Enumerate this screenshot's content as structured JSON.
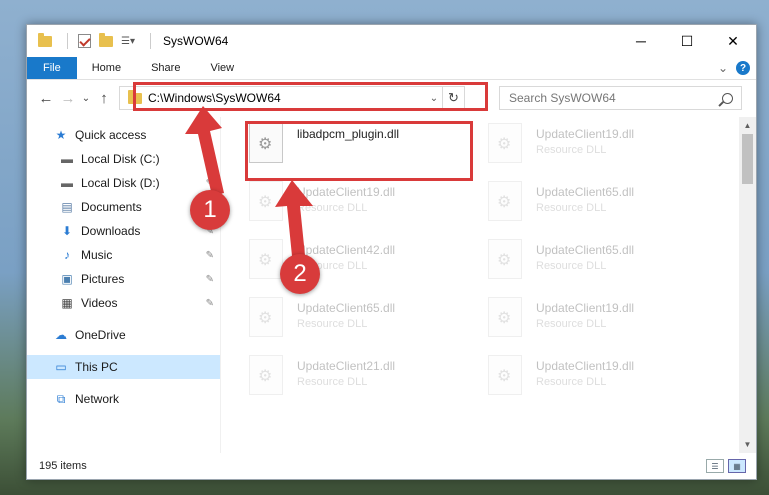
{
  "window": {
    "title": "SysWOW64",
    "controls": {
      "minimize": "─",
      "maximize": "☐",
      "close": "✕"
    }
  },
  "ribbon": {
    "tabs": [
      {
        "label": "File"
      },
      {
        "label": "Home"
      },
      {
        "label": "Share"
      },
      {
        "label": "View"
      }
    ],
    "collapse": "⌄",
    "help": "?"
  },
  "address": {
    "path": "C:\\Windows\\SysWOW64",
    "search_placeholder": "Search SysWOW64"
  },
  "nav": {
    "back": "←",
    "forward": "→",
    "recent": "⌄",
    "up": "↑"
  },
  "sidebar": {
    "items": [
      {
        "label": "Quick access",
        "icon": "star-icon",
        "glyph": "★"
      },
      {
        "label": "Local Disk (C:)",
        "icon": "drive-icon",
        "glyph": "▬"
      },
      {
        "label": "Local Disk (D:)",
        "icon": "drive-icon",
        "glyph": "▬"
      },
      {
        "label": "Documents",
        "icon": "document-icon",
        "glyph": "▤"
      },
      {
        "label": "Downloads",
        "icon": "download-icon",
        "glyph": "⬇"
      },
      {
        "label": "Music",
        "icon": "music-icon",
        "glyph": "♪"
      },
      {
        "label": "Pictures",
        "icon": "picture-icon",
        "glyph": "▣"
      },
      {
        "label": "Videos",
        "icon": "video-icon",
        "glyph": "▦"
      },
      {
        "label": "OneDrive",
        "icon": "cloud-icon",
        "glyph": "☁"
      },
      {
        "label": "This PC",
        "icon": "computer-icon",
        "glyph": "▭"
      },
      {
        "label": "Network",
        "icon": "network-icon",
        "glyph": "⧉"
      }
    ],
    "pin": "📌"
  },
  "files": [
    {
      "name": "libadpcm_plugin.dll",
      "type": ""
    },
    {
      "name": "UpdateClient19.dll",
      "type": "Resource DLL"
    },
    {
      "name": "UpdateClient19.dll",
      "type": "Resource DLL"
    },
    {
      "name": "UpdateClient65.dll",
      "type": "Resource DLL"
    },
    {
      "name": "UpdateClient42.dll",
      "type": "Resource DLL"
    },
    {
      "name": "UpdateClient65.dll",
      "type": "Resource DLL"
    },
    {
      "name": "UpdateClient65.dll",
      "type": "Resource DLL"
    },
    {
      "name": "UpdateClient19.dll",
      "type": "Resource DLL"
    },
    {
      "name": "UpdateClient21.dll",
      "type": "Resource DLL"
    },
    {
      "name": "UpdateClient19.dll",
      "type": "Resource DLL"
    }
  ],
  "status": {
    "count": "195 items"
  },
  "annotations": {
    "step1": "1",
    "step2": "2",
    "color": "#d93a3a"
  },
  "colors": {
    "accent": "#1979ca",
    "selection": "#cce8ff",
    "highlight": "#d93a3a"
  }
}
